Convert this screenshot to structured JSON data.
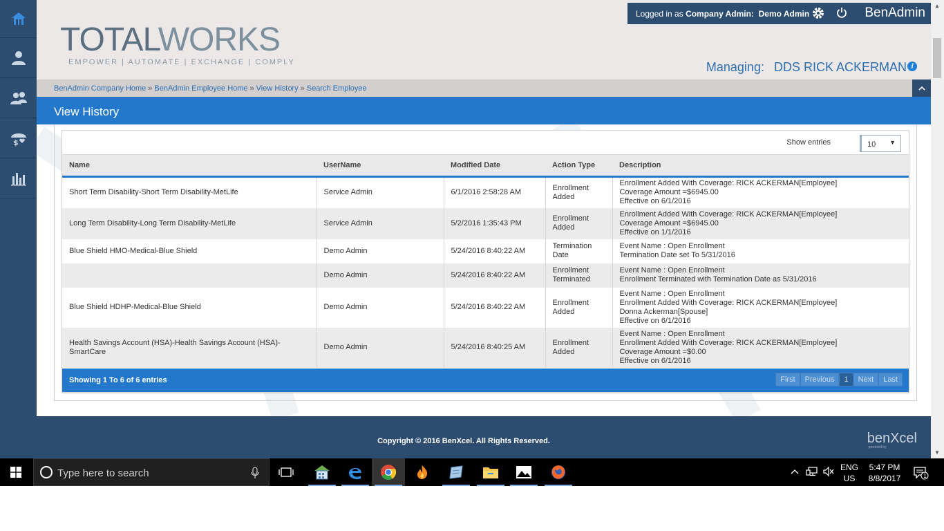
{
  "header": {
    "logo_total": "TOTAL",
    "logo_works": "WORKS",
    "logo_tagline": "EMPOWER  |  AUTOMATE  |  EXCHANGE  |  COMPLY",
    "login_prefix": "Logged in as ",
    "login_role": "Company Admin:",
    "login_user": "Demo Admin",
    "brand": "BenAdmin",
    "managing_label": "Managing:",
    "managing_name": "DDS RICK ACKERMAN"
  },
  "breadcrumb": {
    "items": [
      "BenAdmin Company Home",
      "BenAdmin Employee Home",
      "View History",
      "Search Employee"
    ],
    "separator": "»"
  },
  "page": {
    "title": "View History"
  },
  "grid": {
    "show_entries_label": "Show entries",
    "entries_value": "10",
    "columns": [
      "Name",
      "UserName",
      "Modified Date",
      "Action Type",
      "Description"
    ],
    "rows": [
      {
        "name": "Short Term Disability-Short Term Disability-MetLife",
        "user": "Service Admin",
        "date": "6/1/2016 2:58:28 AM",
        "action": [
          "Enrollment",
          "Added"
        ],
        "desc": [
          "Enrollment Added With Coverage: RICK ACKERMAN[Employee]",
          "Coverage Amount =$6945.00",
          "Effective on 6/1/2016"
        ]
      },
      {
        "name": "Long Term Disability-Long Term Disability-MetLife",
        "user": "Service Admin",
        "date": "5/2/2016 1:35:43 PM",
        "action": [
          "Enrollment",
          "Added"
        ],
        "desc": [
          "Enrollment Added With Coverage: RICK ACKERMAN[Employee]",
          "Coverage Amount =$6945.00",
          "Effective on 1/1/2016"
        ]
      },
      {
        "name": "Blue Shield HMO-Medical-Blue Shield",
        "user": "Demo Admin",
        "date": "5/24/2016 8:40:22 AM",
        "action": [
          "Termination Date"
        ],
        "desc": [
          "Event Name : Open Enrollment",
          "Termination Date set To 5/31/2016"
        ]
      },
      {
        "name": "",
        "user": "Demo Admin",
        "date": "5/24/2016 8:40:22 AM",
        "action": [
          "Enrollment",
          "Terminated"
        ],
        "desc": [
          "Event Name : Open Enrollment",
          "Enrollment Terminated with Termination Date as 5/31/2016"
        ]
      },
      {
        "name": "Blue Shield HDHP-Medical-Blue Shield",
        "user": "Demo Admin",
        "date": "5/24/2016 8:40:22 AM",
        "action": [
          "Enrollment",
          "Added"
        ],
        "desc": [
          "Event Name : Open Enrollment",
          "Enrollment Added With Coverage: RICK ACKERMAN[Employee]",
          "Donna Ackerman[Spouse]",
          "Effective on 6/1/2016"
        ]
      },
      {
        "name": "Health Savings Account (HSA)-Health Savings Account (HSA)-SmartCare",
        "user": "Demo Admin",
        "date": "5/24/2016 8:40:25 AM",
        "action": [
          "Enrollment",
          "Added"
        ],
        "desc": [
          "Event Name : Open Enrollment",
          "Enrollment Added With Coverage: RICK ACKERMAN[Employee]",
          "Coverage Amount =$0.00",
          "Effective on 6/1/2016"
        ]
      }
    ],
    "showing_text": "Showing 1 To 6 of 6 entries",
    "pager": {
      "first": "First",
      "previous": "Previous",
      "current": "1",
      "next": "Next",
      "last": "Last"
    }
  },
  "footer": {
    "copyright": "Copyright © 2016 BenXcel. All Rights Reserved.",
    "brand": "benXcel",
    "brand_sub": "powered by"
  },
  "taskbar": {
    "search_placeholder": "Type here to search",
    "lang_top": "ENG",
    "lang_bottom": "US",
    "time": "5:47 PM",
    "date": "8/8/2017",
    "notif_count": "1"
  },
  "colors": {
    "primary_blue": "#2478cc",
    "navy": "#2d4d70",
    "link": "#2a6db0"
  }
}
